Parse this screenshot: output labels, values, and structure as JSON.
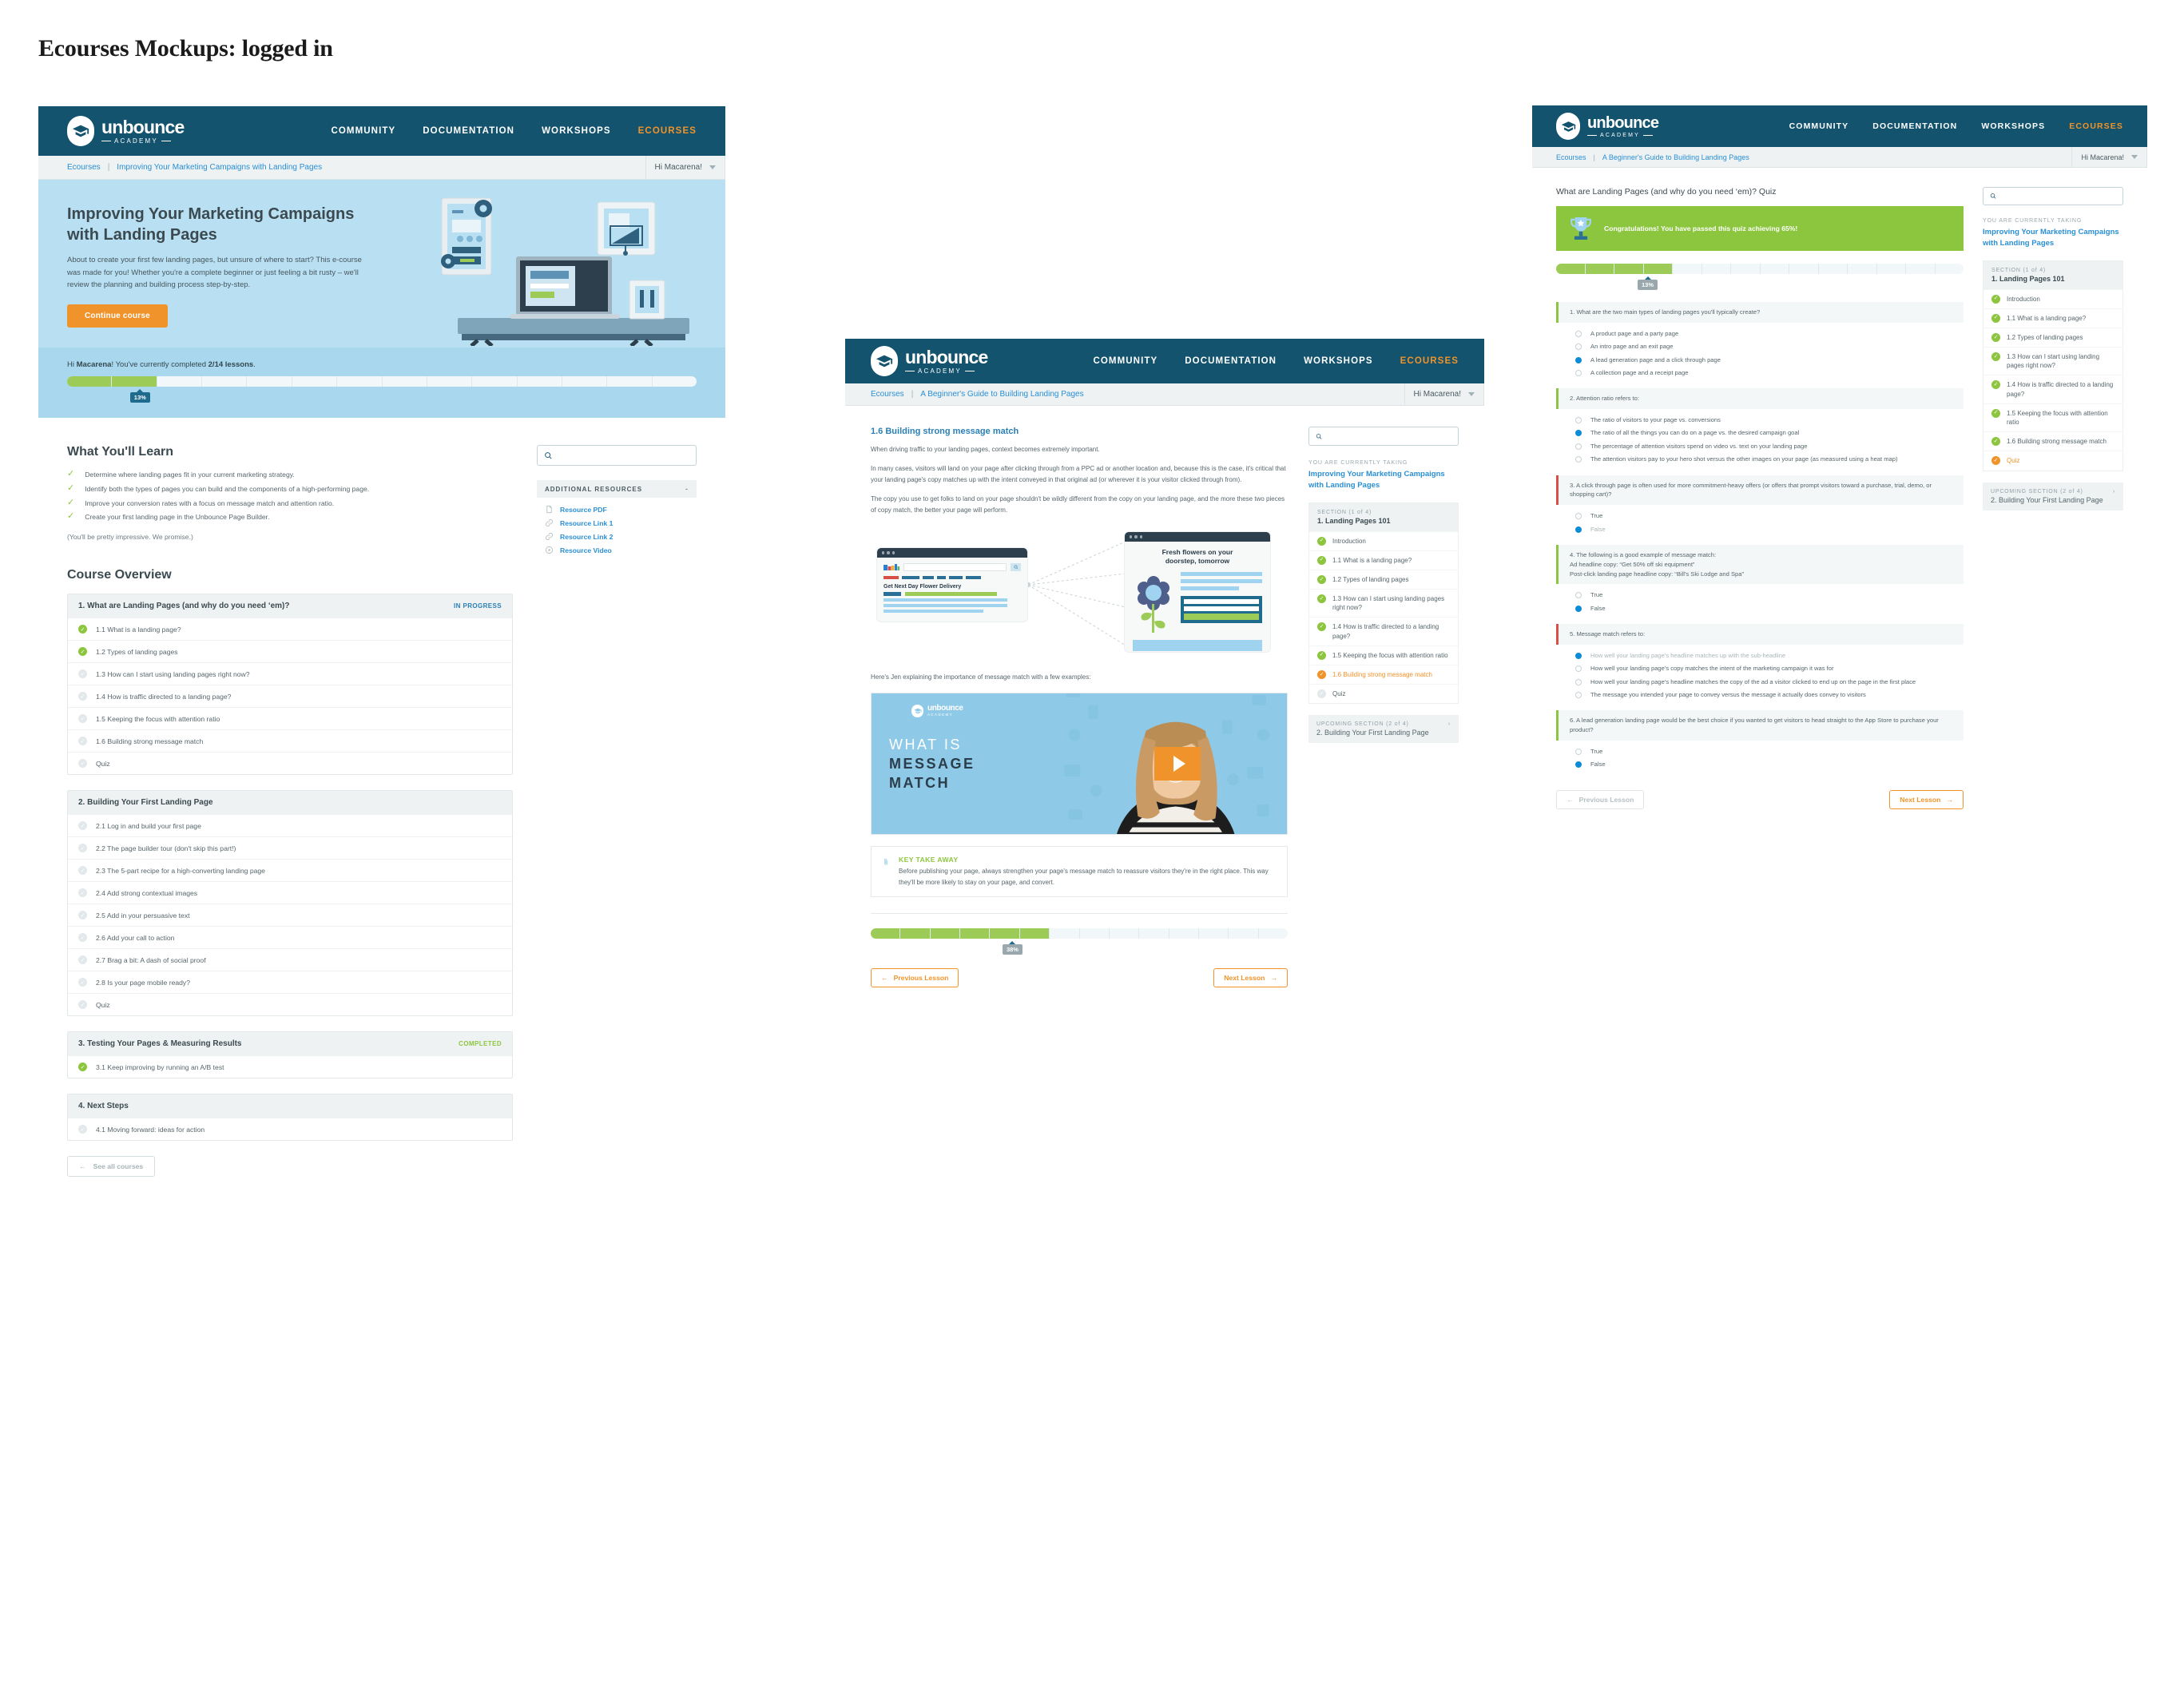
{
  "page": {
    "title": "Ecourses Mockups: logged in"
  },
  "brand": {
    "logo_word": "unbounce",
    "logo_sub": "ACADEMY",
    "accent_orange": "#f0932a",
    "nav_blue": "#13536e",
    "link_blue": "#2a8fd4",
    "green": "#8cc63e"
  },
  "nav": {
    "items": [
      {
        "label": "COMMUNITY",
        "active": false
      },
      {
        "label": "DOCUMENTATION",
        "active": false
      },
      {
        "label": "WORKSHOPS",
        "active": false
      },
      {
        "label": "ECOURSES",
        "active": true
      }
    ]
  },
  "mockup1": {
    "breadcrumb": {
      "home": "Ecourses",
      "sep": "|",
      "current": "Improving Your Marketing Campaigns with Landing Pages"
    },
    "user": {
      "greeting": "Hi Macarena!"
    },
    "hero": {
      "title": "Improving Your Marketing Campaigns with Landing Pages",
      "body": "About to create your first few landing pages, but unsure of where to start? This e-course was made for you! Whether you're a complete beginner or just feeling a bit rusty – we'll review the planning and building process step-by-step.",
      "cta": "Continue course"
    },
    "progress": {
      "greeting_pre": "Hi ",
      "name": "Macarena",
      "greeting_mid": "! You've currently completed ",
      "lessons": "2/14 lessons",
      "greeting_post": ".",
      "percent_label": "13%",
      "total_segments": 14,
      "completed_segments": 2
    },
    "learn": {
      "heading": "What You'll Learn",
      "items": [
        "Determine where landing pages fit in your current marketing strategy.",
        "Identify both the types of pages you can build and the components of a high-performing page.",
        "Improve your conversion rates with a focus on message match and attention ratio.",
        "Create your first landing page in the Unbounce Page Builder."
      ],
      "promise": "(You'll be pretty impressive. We promise.)"
    },
    "search": {
      "placeholder": ""
    },
    "resources": {
      "heading": "ADDITIONAL RESOURCES",
      "collapse": "-",
      "items": [
        {
          "label": "Resource PDF",
          "icon": "document-icon"
        },
        {
          "label": "Resource Link 1",
          "icon": "link-icon"
        },
        {
          "label": "Resource Link 2",
          "icon": "link-icon"
        },
        {
          "label": "Resource Video",
          "icon": "play-circle-icon"
        }
      ]
    },
    "overview": {
      "heading": "Course Overview",
      "sections": [
        {
          "title": "1. What are Landing Pages (and why do you need ‘em)?",
          "status": "IN PROGRESS",
          "status_kind": "prog",
          "lessons": [
            {
              "label": "1.1 What is a landing page?",
              "done": true
            },
            {
              "label": "1.2 Types of landing pages",
              "done": true
            },
            {
              "label": "1.3 How can I start using landing pages right now?",
              "done": false
            },
            {
              "label": "1.4 How is traffic directed to a landing page?",
              "done": false
            },
            {
              "label": "1.5 Keeping the focus with attention ratio",
              "done": false
            },
            {
              "label": "1.6 Building strong message match",
              "done": false
            },
            {
              "label": "Quiz",
              "done": false
            }
          ]
        },
        {
          "title": "2. Building Your First Landing Page",
          "status": "",
          "status_kind": "",
          "lessons": [
            {
              "label": "2.1 Log in and build your first page",
              "done": false
            },
            {
              "label": "2.2 The page builder tour (don't skip this part!)",
              "done": false
            },
            {
              "label": "2.3 The 5-part recipe for a high-converting landing page",
              "done": false
            },
            {
              "label": "2.4 Add strong contextual images",
              "done": false
            },
            {
              "label": "2.5 Add in your persuasive text",
              "done": false
            },
            {
              "label": "2.6 Add your call to action",
              "done": false
            },
            {
              "label": "2.7 Brag a bit: A dash of social proof",
              "done": false
            },
            {
              "label": "2.8 Is your page mobile ready?",
              "done": false
            },
            {
              "label": "Quiz",
              "done": false
            }
          ]
        },
        {
          "title": "3. Testing Your Pages & Measuring Results",
          "status": "COMPLETED",
          "status_kind": "done",
          "lessons": [
            {
              "label": "3.1 Keep improving by running an A/B test",
              "done": true
            }
          ]
        },
        {
          "title": "4. Next Steps",
          "status": "",
          "status_kind": "",
          "lessons": [
            {
              "label": "4.1 Moving forward: ideas for action",
              "done": false
            }
          ]
        }
      ],
      "see_all": "See all courses",
      "see_all_arrow": "←"
    }
  },
  "mockup2": {
    "breadcrumb": {
      "home": "Ecourses",
      "sep": "|",
      "current": "A Beginner's Guide to Building Landing Pages"
    },
    "user": {
      "greeting": "Hi Macarena!"
    },
    "lesson": {
      "title": "1.6 Building strong message match",
      "paragraphs": [
        "When driving traffic to your landing pages, context becomes extremely important.",
        "In many cases, visitors will land on your page after clicking through from a PPC ad or another location and, because this is the case, it's critical that your landing page's copy matches up with the intent conveyed in that original ad (or wherever it is your visitor clicked through from).",
        "The copy you use to get folks to land on your page shouldn't be wildly different from the copy on your landing page, and the more these two pieces of copy match, the better your page will perform."
      ],
      "illustration": {
        "ad_headline": "Get Next Day Flower Delivery",
        "lp_headline_line1": "Fresh flowers on your",
        "lp_headline_line2": "doorstep, tomorrow"
      },
      "video_intro": "Here's Jen explaining the importance of message match with a few examples:",
      "video": {
        "line1": "WHAT IS",
        "line2": "MESSAGE",
        "line3": "MATCH",
        "logo_word": "unbounce",
        "logo_sub": "ACADEMY"
      },
      "takeaway": {
        "title": "KEY TAKE AWAY",
        "body": "Before publishing your page, always strengthen your page's message match to reassure visitors they're in the right place. This way they'll be more likely to stay on your page, and convert."
      },
      "progress": {
        "percent_label": "38%",
        "total_segments": 14,
        "completed_segments": 6
      },
      "prev": "Previous Lesson",
      "next": "Next Lesson",
      "prev_arrow": "←",
      "next_arrow": "→"
    },
    "search": {
      "placeholder": ""
    },
    "sidenav": {
      "currently_label": "YOU ARE CURRENTLY TAKING",
      "course": "Improving Your Marketing Campaigns with Landing Pages",
      "section_label": "SECTION (1 of 4)",
      "section_title": "1. Landing Pages 101",
      "items": [
        {
          "label": "Introduction",
          "state": "done"
        },
        {
          "label": "1.1 What is a landing page?",
          "state": "done"
        },
        {
          "label": "1.2 Types of landing pages",
          "state": "done"
        },
        {
          "label": "1.3 How can I start using landing pages right now?",
          "state": "done"
        },
        {
          "label": "1.4 How is traffic directed to a landing page?",
          "state": "done"
        },
        {
          "label": "1.5 Keeping the focus with attention ratio",
          "state": "done"
        },
        {
          "label": "1.6 Building strong message match",
          "state": "current"
        },
        {
          "label": "Quiz",
          "state": "todo"
        }
      ],
      "upcoming_label": "UPCOMING SECTION (2 of 4)",
      "upcoming_title": "2. Building Your First Landing Page",
      "upcoming_arrow": "›"
    }
  },
  "mockup3": {
    "breadcrumb": {
      "home": "Ecourses",
      "sep": "|",
      "current": "A Beginner's Guide to Building Landing Pages"
    },
    "user": {
      "greeting": "Hi Macarena!"
    },
    "quiz": {
      "title": "What are Landing Pages (and why do you need ‘em)? Quiz",
      "congrats": "Congratulations! You have passed this quiz achieving 65%!",
      "progress": {
        "percent_label": "13%",
        "total_segments": 14,
        "completed_segments": 4
      },
      "questions": [
        {
          "text": "1. What are the two main types of landing pages you'll typically create?",
          "accent": "green",
          "options": [
            {
              "label": "A product page and a party page",
              "selected": false,
              "muted": false
            },
            {
              "label": "An intro page and an exit page",
              "selected": false,
              "muted": false
            },
            {
              "label": "A lead generation page and a click through page",
              "selected": true,
              "muted": false
            },
            {
              "label": "A collection page and a receipt page",
              "selected": false,
              "muted": false
            }
          ]
        },
        {
          "text": "2. Attention ratio refers to:",
          "accent": "green",
          "options": [
            {
              "label": "The ratio of visitors to your page vs. conversions",
              "selected": false,
              "muted": false
            },
            {
              "label": "The ratio of all the things you can do on a page vs. the desired campaign goal",
              "selected": true,
              "muted": false
            },
            {
              "label": "The percentage of attention visitors spend on video vs. text on your landing page",
              "selected": false,
              "muted": false
            },
            {
              "label": "The attention visitors pay to your hero shot versus the other images on your page (as measured using a heat map)",
              "selected": false,
              "muted": false
            }
          ]
        },
        {
          "text": "3. A click through page is often used for more commitment-heavy offers (or offers that prompt visitors toward a purchase, trial, demo, or shopping cart)?",
          "accent": "red",
          "options": [
            {
              "label": "True",
              "selected": false,
              "muted": false
            },
            {
              "label": "False",
              "selected": true,
              "muted": true
            }
          ]
        },
        {
          "text": "4. The following is a good example of message match:\nAd headline copy: “Get 50% off ski equipment”\nPost-click landing page headline copy: “Bill's Ski Lodge and Spa”",
          "accent": "green",
          "options": [
            {
              "label": "True",
              "selected": false,
              "muted": false
            },
            {
              "label": "False",
              "selected": true,
              "muted": false
            }
          ]
        },
        {
          "text": "5. Message match refers to:",
          "accent": "red",
          "options": [
            {
              "label": "How well your landing page's headline matches up with the sub-headline",
              "selected": true,
              "muted": true
            },
            {
              "label": "How well your landing page's copy matches the intent of the marketing campaign it was for",
              "selected": false,
              "muted": false
            },
            {
              "label": "How well your landing page's headline matches the copy of the ad a visitor clicked to end up on the page in the first place",
              "selected": false,
              "muted": false
            },
            {
              "label": "The message you intended your page to convey versus the message it actually does convey to visitors",
              "selected": false,
              "muted": false
            }
          ]
        },
        {
          "text": "6. A lead generation landing page would be the best choice if you wanted to get visitors to head straight to the App Store to purchase your product?",
          "accent": "green",
          "options": [
            {
              "label": "True",
              "selected": false,
              "muted": false
            },
            {
              "label": "False",
              "selected": true,
              "muted": false
            }
          ]
        }
      ],
      "prev": "Previous Lesson",
      "next": "Next Lesson",
      "prev_arrow": "←",
      "next_arrow": "→"
    },
    "search": {
      "placeholder": ""
    },
    "sidenav": {
      "currently_label": "YOU ARE CURRENTLY TAKING",
      "course": "Improving Your Marketing Campaigns with Landing Pages",
      "section_label": "SECTION (1 of 4)",
      "section_title": "1. Landing Pages 101",
      "items": [
        {
          "label": "Introduction",
          "state": "done"
        },
        {
          "label": "1.1 What is a landing page?",
          "state": "done"
        },
        {
          "label": "1.2 Types of landing pages",
          "state": "done"
        },
        {
          "label": "1.3 How can I start using landing pages right now?",
          "state": "done"
        },
        {
          "label": "1.4 How is traffic directed to a landing page?",
          "state": "done"
        },
        {
          "label": "1.5 Keeping the focus with attention ratio",
          "state": "done"
        },
        {
          "label": "1.6 Building strong message match",
          "state": "done"
        },
        {
          "label": "Quiz",
          "state": "current"
        }
      ],
      "upcoming_label": "UPCOMING SECTION (2 of 4)",
      "upcoming_title": "2. Building Your First Landing Page",
      "upcoming_arrow": "›"
    }
  }
}
